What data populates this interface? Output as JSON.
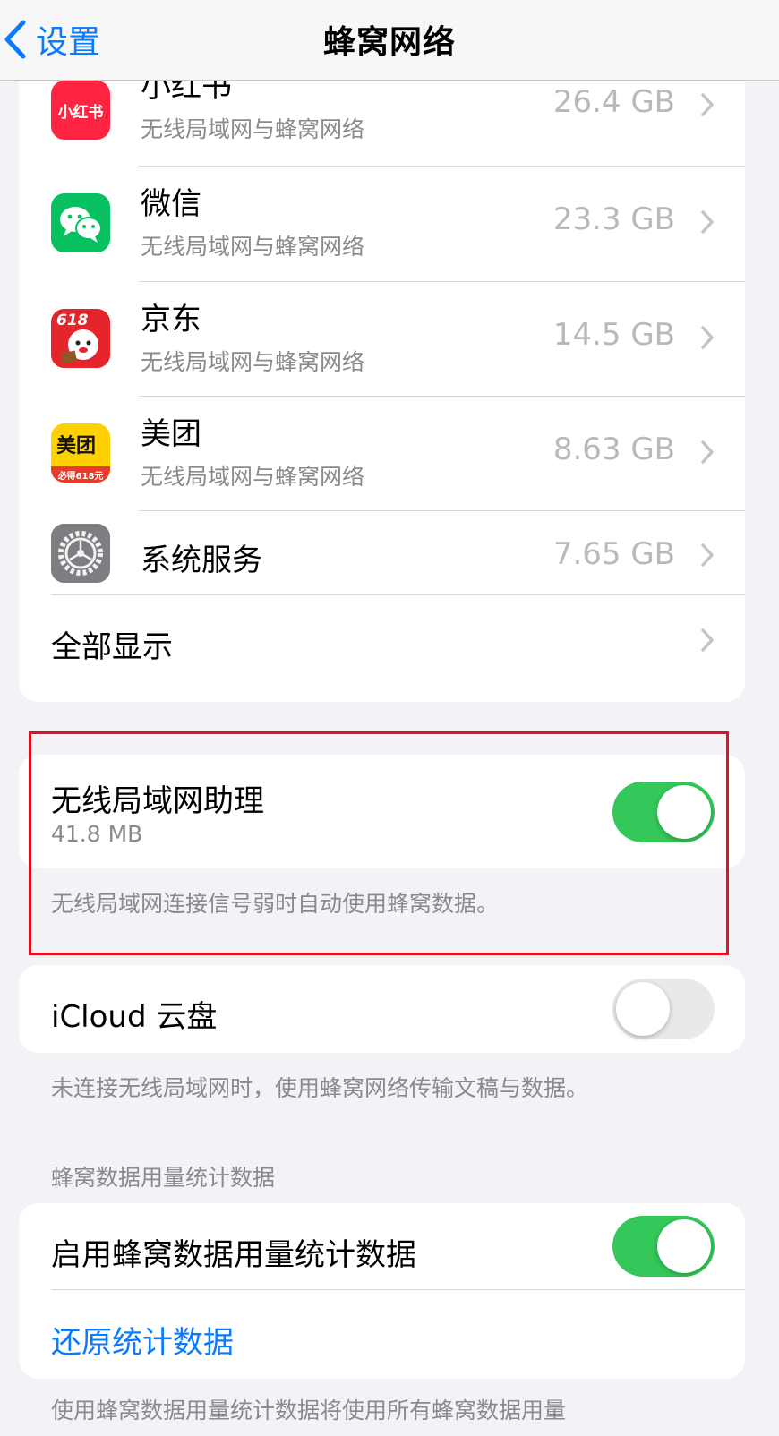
{
  "nav": {
    "back_label": "设置",
    "title": "蜂窝网络"
  },
  "apps": [
    {
      "name": "小红书",
      "subtitle": "无线局域网与蜂窝网络",
      "usage": "26.4 GB",
      "icon": "xiaohongshu-icon",
      "icon_text": "小红书",
      "color": "#ff2442"
    },
    {
      "name": "微信",
      "subtitle": "无线局域网与蜂窝网络",
      "usage": "23.3 GB",
      "icon": "wechat-icon",
      "color": "#07c160"
    },
    {
      "name": "京东",
      "subtitle": "无线局域网与蜂窝网络",
      "usage": "14.5 GB",
      "icon": "jd-icon",
      "icon_text": "618",
      "color": "#e1251b"
    },
    {
      "name": "美团",
      "subtitle": "无线局域网与蜂窝网络",
      "usage": "8.63 GB",
      "icon": "meituan-icon",
      "icon_text": "美团",
      "icon_subtext": "必得618元",
      "color": "#ffd100"
    },
    {
      "name": "系统服务",
      "usage": "7.65 GB",
      "icon": "gear-icon",
      "color": "#8e8e93"
    }
  ],
  "show_all_label": "全部显示",
  "wifi_assist": {
    "label": "无线局域网助理",
    "usage": "41.8 MB",
    "enabled": true,
    "footer": "无线局域网连接信号弱时自动使用蜂窝数据。"
  },
  "icloud": {
    "label": "iCloud 云盘",
    "enabled": false,
    "footer": "未连接无线局域网时，使用蜂窝网络传输文稿与数据。"
  },
  "stats_section": {
    "header": "蜂窝数据用量统计数据",
    "enable_label": "启用蜂窝数据用量统计数据",
    "enabled": true,
    "reset_label": "还原统计数据",
    "footer_partial": "使用蜂窝数据用量统计数据将使用所有蜂窝数据用量"
  },
  "colors": {
    "accent": "#0a7aff",
    "toggle_on": "#34c759",
    "highlight": "#e0121b"
  }
}
